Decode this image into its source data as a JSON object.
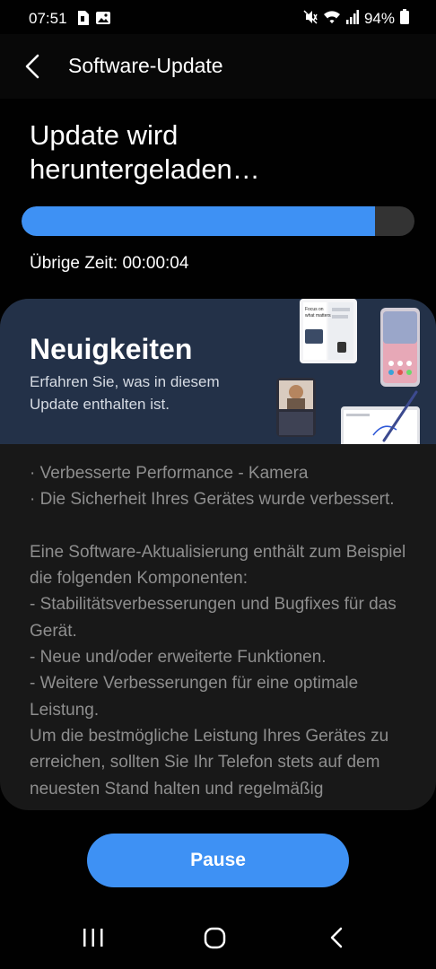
{
  "status_bar": {
    "time": "07:51",
    "battery": "94%",
    "icons": [
      "sim-card-icon",
      "gallery-icon",
      "mute-icon",
      "wifi-icon",
      "signal-icon",
      "battery-icon"
    ]
  },
  "app_bar": {
    "title": "Software-Update",
    "back_icon": "chevron-left-icon"
  },
  "download": {
    "heading": "Update wird heruntergeladen…",
    "progress_fraction": 0.9,
    "remaining_time": "Übrige Zeit: 00:00:04"
  },
  "news_card": {
    "title": "Neuigkeiten",
    "subtitle": "Erfahren Sie, was in diesem Update enthalten ist.",
    "promo_texts": [
      "Focus on what matters"
    ],
    "body": "· Verbesserte Performance - Kamera\n· Die Sicherheit Ihres Gerätes wurde verbessert.\n\nEine Software-Aktualisierung enthält zum Beispiel die folgenden Komponenten:\n - Stabilitätsverbesserungen und Bugfixes für das Gerät.\n - Neue und/oder erweiterte Funktionen.\n - Weitere Verbesserungen für eine optimale Leistung.\nUm die bestmögliche Leistung Ihres Gerätes zu erreichen, sollten Sie Ihr Telefon stets auf dem neuesten Stand halten und regelmäßig"
  },
  "pause_button": {
    "label": "Pause"
  },
  "nav_bar": {
    "icons": [
      "recents-icon",
      "home-icon",
      "back-icon"
    ]
  },
  "colors": {
    "accent": "#3e91f4",
    "background": "#010101",
    "card": "#181818",
    "banner": "#233148",
    "progress_track": "#333333",
    "body_text": "#8e8e8e"
  }
}
